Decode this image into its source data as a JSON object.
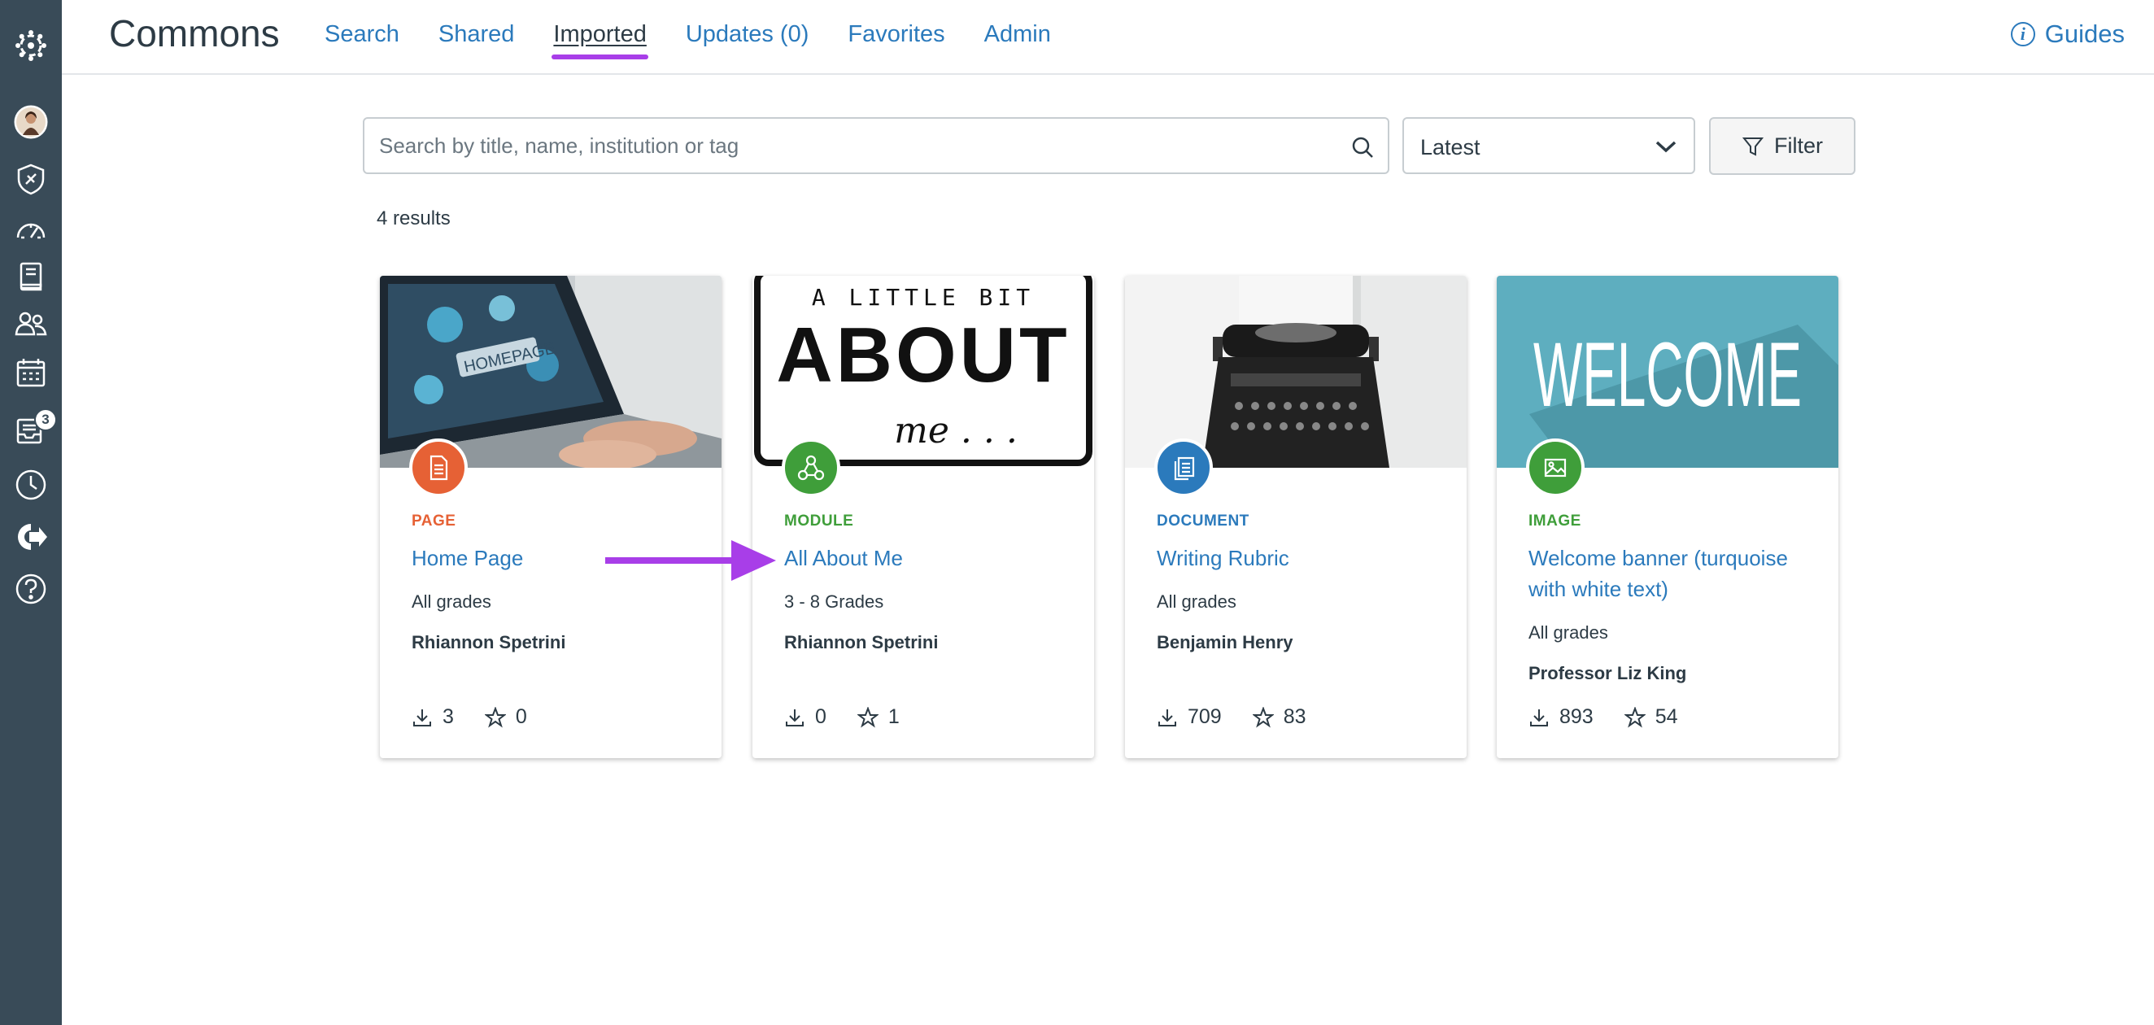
{
  "header": {
    "app_title": "Commons",
    "tabs": [
      {
        "label": "Search"
      },
      {
        "label": "Shared"
      },
      {
        "label": "Imported"
      },
      {
        "label": "Updates (0)"
      },
      {
        "label": "Favorites"
      },
      {
        "label": "Admin"
      }
    ],
    "active_tab": "Imported",
    "guides_label": "Guides"
  },
  "global_nav": {
    "items": [
      "canvas-logo",
      "account",
      "admin",
      "dashboard",
      "courses",
      "groups",
      "calendar",
      "inbox",
      "history",
      "commons",
      "help"
    ],
    "inbox_badge": "3"
  },
  "search": {
    "placeholder": "Search by title, name, institution or tag",
    "value": ""
  },
  "sort": {
    "selected": "Latest"
  },
  "filter": {
    "label": "Filter"
  },
  "results": {
    "count_text": "4 results"
  },
  "cards": [
    {
      "type": "PAGE",
      "type_color": "#e66135",
      "title": "Home Page",
      "grades": "All grades",
      "author": "Rhiannon Spetrini",
      "downloads": "3",
      "favorites": "0"
    },
    {
      "type": "MODULE",
      "type_color": "#3f9e3a",
      "title": "All About Me",
      "grades": "3 - 8 Grades",
      "author": "Rhiannon Spetrini",
      "downloads": "0",
      "favorites": "1",
      "thumb_text_1": "A LITTLE BIT",
      "thumb_text_2": "ABOUT",
      "thumb_text_3": "me . . ."
    },
    {
      "type": "DOCUMENT",
      "type_color": "#2b7abc",
      "title": "Writing Rubric",
      "grades": "All grades",
      "author": "Benjamin Henry",
      "downloads": "709",
      "favorites": "83"
    },
    {
      "type": "IMAGE",
      "type_color": "#3f9e3a",
      "title": "Welcome banner (turquoise with white text)",
      "grades": "All grades",
      "author": "Professor Liz King",
      "downloads": "893",
      "favorites": "54",
      "thumb_text": "WELCOME"
    }
  ],
  "colors": {
    "nav_bg": "#394b58",
    "link": "#2b7abc",
    "active_underline": "#a83ee8",
    "arrow": "#a83ee8"
  }
}
